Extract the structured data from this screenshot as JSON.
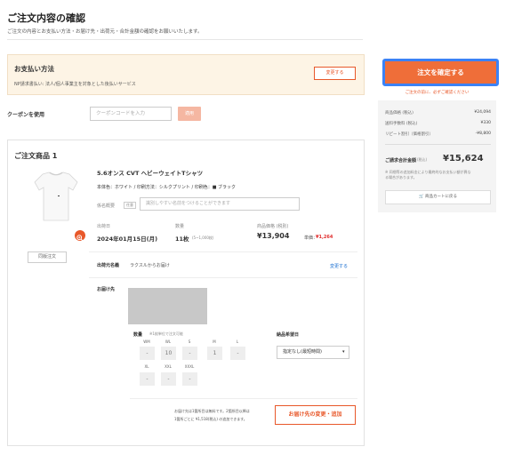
{
  "page": {
    "title": "ご注文内容の確認",
    "subtitle": "ご注文の内容とお支払い方法・お届け先・出荷元・合計金額の確認をお願いいたします。"
  },
  "payment": {
    "title": "お支払い方法",
    "method": "NP請求書払い: 法人/個人事業主を対象とした後払いサービス",
    "change_label": "変更する"
  },
  "coupon": {
    "label": "クーポンを使用",
    "placeholder": "クーポンコードを入力",
    "apply_label": "適用"
  },
  "order": {
    "title": "ご注文商品 1",
    "design_button": "同版注文",
    "product_name": "5.6オンス CVT ヘビーウェイトTシャツ",
    "spec": "本体色：ホワイト / 印刷方法：シルクプリント / 印刷色：■ ブラック",
    "manage_label": "係名概要",
    "manage_badge": "任意",
    "manage_placeholder": "識別しやすい名前をつけることができます",
    "ship_date_label": "出荷日",
    "ship_date": "2024年01月15日(月)",
    "qty_label": "数量",
    "qty": "11枚",
    "qty_note": "(5~1,000枚)",
    "price_label": "商品価格 (税別)",
    "price": "¥13,904",
    "unit_label": "単価：",
    "unit_price": "¥1,264",
    "shipper_label": "出荷元名義",
    "shipper_value": "ラクスルからお届け",
    "shipper_change": "変更する",
    "dest_label": "お届け先",
    "size_label": "数量",
    "size_note": "※1枚単位で注文可能",
    "sizes_row1": [
      "WM",
      "WL",
      "S",
      "M",
      "L"
    ],
    "qty_row1": [
      "-",
      "10",
      "-",
      "1",
      "-"
    ],
    "sizes_row2": [
      "XL",
      "XXL",
      "XXXL"
    ],
    "qty_row2": [
      "-",
      "-",
      "-"
    ],
    "delivery_label": "納品希望日",
    "delivery_value": "指定なし(最短時間)",
    "dest_note1": "お届け先は1箇所目は無料です。2箇所目以降は",
    "dest_note2": "1箇所ごとに ¥1,518(税込) の追加できます。",
    "dest_change_label": "お届け先の変更・追加"
  },
  "summary": {
    "confirm_label": "注文を確定する",
    "confirm_note": "ご注文の前に、必ずご確認ください",
    "subtotal_label": "商品価格 (税込)",
    "subtotal": "¥24,094",
    "shipping_label": "送料手数料 (税込)",
    "shipping": "¥330",
    "repeat_label": "リピート割引（価格割引）",
    "repeat": "-¥8,800",
    "total_label": "ご請求合計金額",
    "total_tax": "(税込)",
    "total": "¥15,624",
    "total_note": "※ 同梱等の追加料金により最終的なお支払い額が異なる場合があります。",
    "back_label": "商品カートに戻る"
  },
  "colors": {
    "accent": "#ef6e39",
    "highlight_border": "#3b82f6",
    "payment_bg": "#fdf4e5"
  }
}
